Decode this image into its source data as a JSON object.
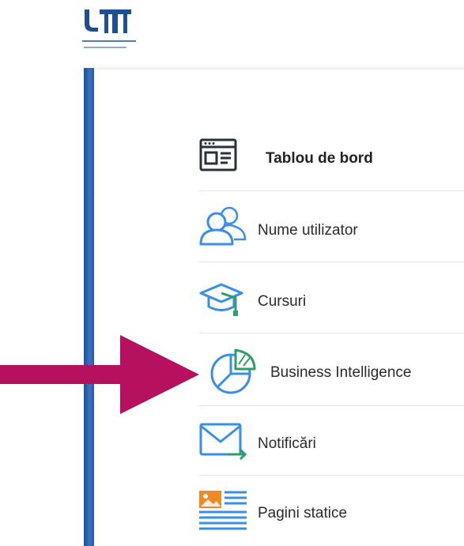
{
  "brand": {
    "logo_text": "UT",
    "logo_color": "#1d4f91",
    "accent_color": "#3a8ee6"
  },
  "menu": {
    "items": [
      {
        "label": "Tablou de bord",
        "icon": "dashboard-icon"
      },
      {
        "label": "Nume utilizator",
        "icon": "users-icon"
      },
      {
        "label": "Cursuri",
        "icon": "graduation-cap-icon"
      },
      {
        "label": "Business Intelligence",
        "icon": "pie-chart-icon"
      },
      {
        "label": "Notificări",
        "icon": "mail-arrow-icon"
      },
      {
        "label": "Pagini statice",
        "icon": "static-page-icon"
      }
    ]
  },
  "annotation": {
    "arrow_color": "#b5115f"
  }
}
